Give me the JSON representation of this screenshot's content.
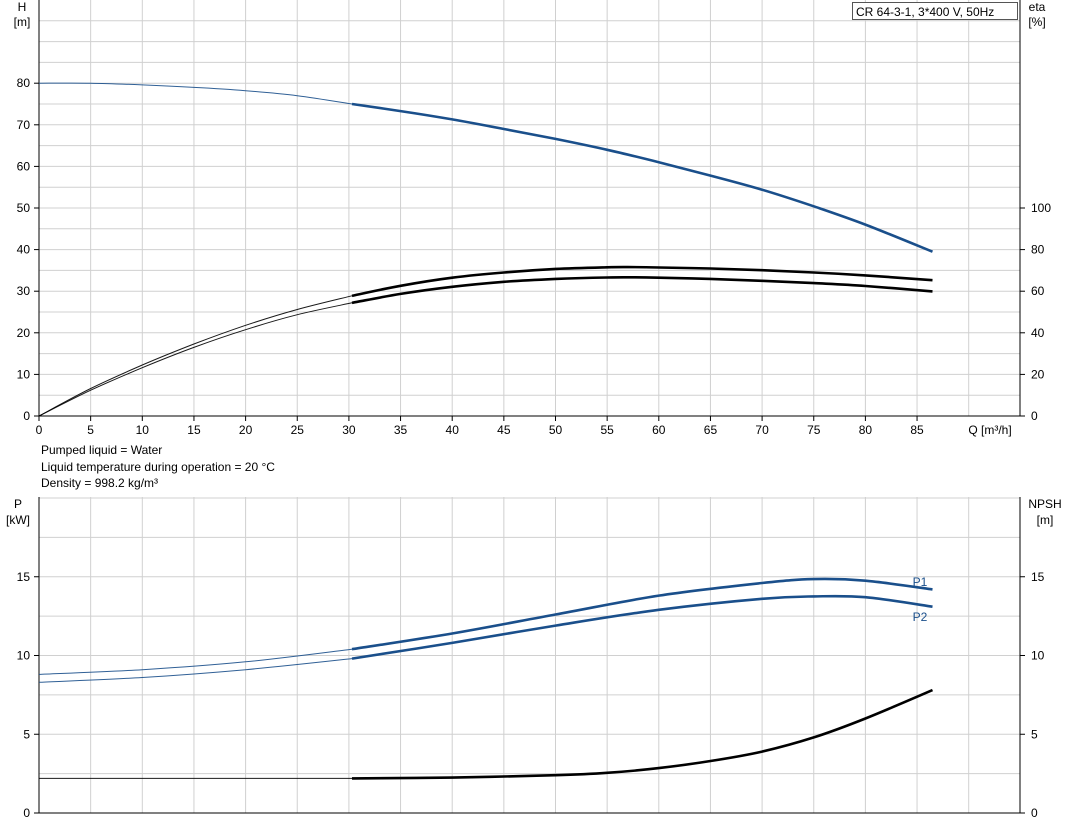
{
  "legend_box": "CR 64-3-1, 3*400 V, 50Hz",
  "info": {
    "line1": "Pumped liquid = Water",
    "line2": "Liquid temperature during operation = 20 °C",
    "line3": "Density = 998.2 kg/m³"
  },
  "colors": {
    "blue": "#1a4f8b",
    "black": "#000000",
    "grid": "#d0d0d0",
    "axis": "#000000"
  },
  "chart_data": [
    {
      "type": "line",
      "title": "CR 64-3-1, 3*400 V, 50Hz",
      "xlabel": "Q [m³/h]",
      "ylabel": "H",
      "ylabel_unit": "[m]",
      "y2label": "eta",
      "y2label_unit": "[%]",
      "xlim": [
        0,
        95
      ],
      "ylim": [
        0,
        95
      ],
      "y2lim": [
        0,
        95
      ],
      "x_ticks": [
        0,
        5,
        10,
        15,
        20,
        25,
        30,
        35,
        40,
        45,
        50,
        55,
        60,
        65,
        70,
        75,
        80,
        85
      ],
      "y_ticks": [
        0,
        10,
        20,
        30,
        40,
        50,
        60,
        70,
        80
      ],
      "y2_ticks": [
        0,
        20,
        40,
        60,
        80,
        100
      ],
      "grid": true,
      "series": [
        {
          "axis": "left",
          "color": "#1a4f8b",
          "x": [
            0,
            5,
            10,
            15,
            20,
            25,
            30.3,
            35,
            40,
            45,
            50,
            55,
            60,
            65,
            70,
            75,
            80,
            86.5
          ],
          "y": [
            80,
            80,
            79.6,
            79,
            78.2,
            77,
            75,
            73.3,
            71.3,
            69,
            66.6,
            64,
            61,
            57.8,
            54.4,
            50.4,
            46,
            39.5
          ]
        },
        {
          "axis": "right",
          "color": "#000000",
          "x": [
            0,
            5,
            10,
            15,
            20,
            25,
            30.3,
            35,
            40,
            45,
            50,
            55,
            57,
            60,
            65,
            70,
            75,
            80,
            86.5
          ],
          "y": [
            0,
            13.2,
            24.5,
            34.6,
            43.6,
            51.2,
            57.8,
            62.6,
            66.5,
            69,
            70.7,
            71.5,
            71.6,
            71.4,
            70.9,
            70.1,
            69,
            67.6,
            65.3
          ]
        },
        {
          "axis": "right",
          "color": "#000000",
          "x": [
            0,
            5,
            10,
            15,
            20,
            25,
            30.3,
            35,
            40,
            45,
            50,
            55,
            57,
            60,
            65,
            70,
            75,
            80,
            86.5
          ],
          "y": [
            0,
            12.4,
            23.2,
            33,
            41.5,
            48.7,
            54.4,
            58.7,
            62.1,
            64.5,
            65.9,
            66.6,
            66.7,
            66.5,
            65.9,
            65,
            63.9,
            62.5,
            59.9
          ]
        }
      ]
    },
    {
      "type": "line",
      "ylabel": "P",
      "ylabel_unit": "[kW]",
      "y2label": "NPSH",
      "y2label_unit": "[m]",
      "xlim": [
        0,
        95
      ],
      "ylim": [
        0,
        20
      ],
      "y2lim": [
        0,
        20
      ],
      "y_ticks": [
        0,
        5,
        10,
        15
      ],
      "y2_ticks": [
        0,
        5,
        10,
        15
      ],
      "grid": true,
      "series": [
        {
          "name": "P1",
          "axis": "left",
          "color": "#1a4f8b",
          "x": [
            0,
            10,
            20,
            30.3,
            40,
            50,
            60,
            70,
            75,
            80,
            86.5
          ],
          "y": [
            8.8,
            9.1,
            9.6,
            10.4,
            11.4,
            12.6,
            13.8,
            14.6,
            14.85,
            14.75,
            14.2
          ]
        },
        {
          "name": "P2",
          "axis": "left",
          "color": "#1a4f8b",
          "x": [
            0,
            10,
            20,
            30.3,
            40,
            50,
            60,
            70,
            75,
            80,
            86.5
          ],
          "y": [
            8.3,
            8.6,
            9.1,
            9.8,
            10.8,
            11.9,
            12.9,
            13.6,
            13.75,
            13.7,
            13.1
          ]
        },
        {
          "axis": "right",
          "color": "#000000",
          "x": [
            0,
            10,
            20,
            30.3,
            40,
            50,
            55,
            60,
            65,
            70,
            75,
            80,
            86.5
          ],
          "y": [
            2.2,
            2.2,
            2.2,
            2.2,
            2.25,
            2.4,
            2.55,
            2.85,
            3.3,
            3.9,
            4.8,
            6,
            7.8
          ]
        }
      ]
    }
  ]
}
